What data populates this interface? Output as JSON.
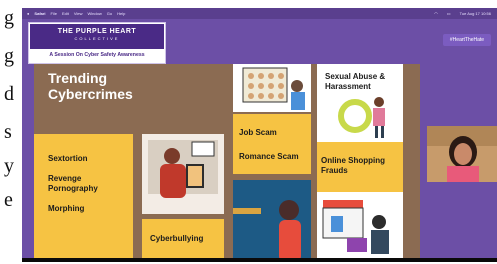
{
  "left_strip": {
    "chars": [
      "g",
      "g",
      "d",
      "s",
      "y",
      "e"
    ]
  },
  "menubar": {
    "items": [
      "Safari",
      "File",
      "Edit",
      "View",
      "Window",
      "Go",
      "Help"
    ],
    "right_time": "Tue Aug 17 10:56"
  },
  "banner": {
    "title": "THE PURPLE HEART",
    "subtitle_small": "COLLECTIVE",
    "session": "A Session On Cyber Safety Awareness"
  },
  "hashtag": "#HeartTheHate",
  "slide": {
    "heading": "Trending Cybercrimes",
    "left_card_items": [
      "Sextortion",
      "Revenge Pornography",
      "Morphing"
    ],
    "cyberbullying": "Cyberbullying",
    "job_scam": "Job Scam",
    "romance_scam": "Romance Scam",
    "sexual_abuse": "Sexual Abuse & Harassment",
    "online_shopping": "Online Shopping Frauds"
  },
  "colors": {
    "purple": "#6c4fa6",
    "slide_brown": "#8b6b52",
    "card_yellow": "#f6c343",
    "card_blue": "#1d5a85"
  }
}
